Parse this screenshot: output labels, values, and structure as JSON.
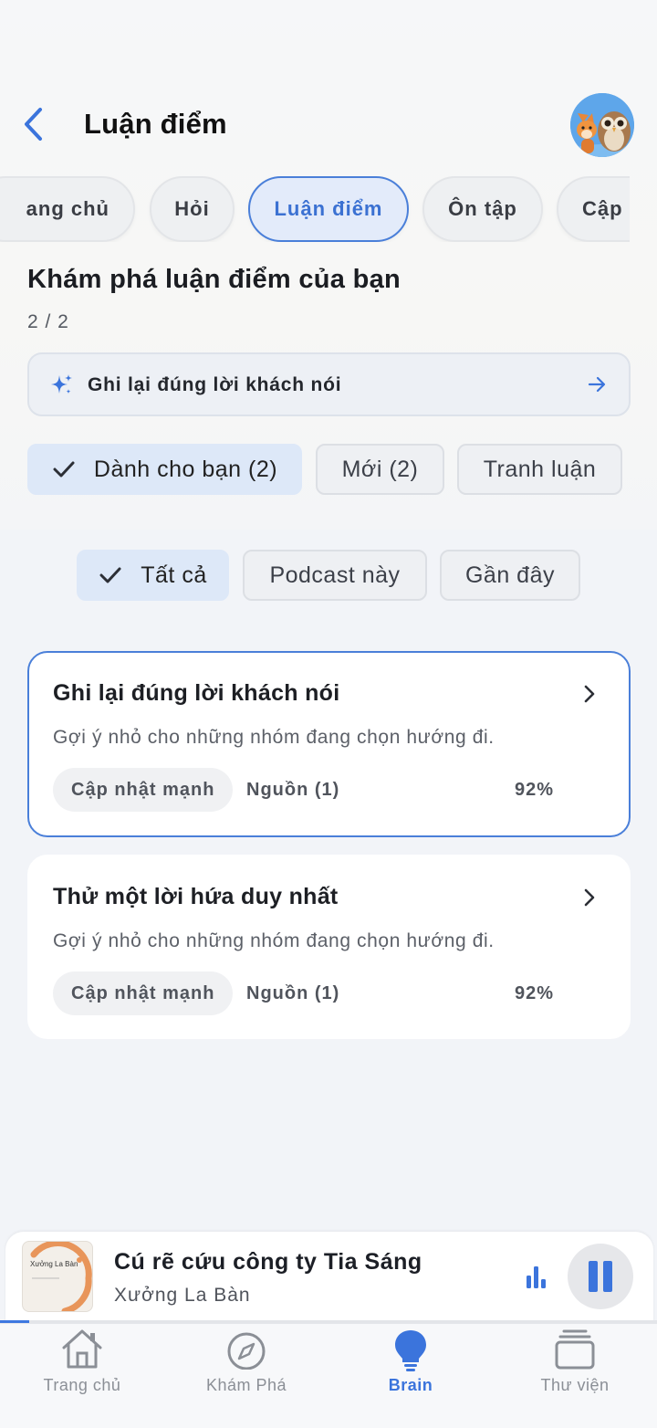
{
  "header": {
    "title": "Luận điểm"
  },
  "tabs": [
    {
      "label": "ang chủ",
      "active": false
    },
    {
      "label": "Hỏi",
      "active": false
    },
    {
      "label": "Luận điểm",
      "active": true
    },
    {
      "label": "Ôn tập",
      "active": false
    },
    {
      "label": "Cập",
      "active": false
    }
  ],
  "section": {
    "title": "Khám phá luận điểm của bạn",
    "page_count": "2 / 2"
  },
  "highlight": {
    "text": "Ghi lại đúng lời khách nói",
    "icon": "sparkle-icon",
    "arrow_icon": "arrow-right-icon"
  },
  "filters": [
    {
      "label": "Dành cho bạn (2)",
      "selected": true
    },
    {
      "label": "Mới (2)",
      "selected": false
    },
    {
      "label": "Tranh luận",
      "selected": false
    }
  ],
  "subfilters": [
    {
      "label": "Tất cả",
      "selected": true
    },
    {
      "label": "Podcast này",
      "selected": false
    },
    {
      "label": "Gần đây",
      "selected": false
    }
  ],
  "cards": [
    {
      "title": "Ghi lại đúng lời khách nói",
      "desc": "Gợi ý nhỏ cho những nhóm đang chọn hướng đi.",
      "tag": "Cập nhật mạnh",
      "source": "Nguồn (1)",
      "pct": "92%",
      "active": true
    },
    {
      "title": "Thử một lời hứa duy nhất",
      "desc": "Gợi ý nhỏ cho những nhóm đang chọn hướng đi.",
      "tag": "Cập nhật mạnh",
      "source": "Nguồn (1)",
      "pct": "92%",
      "active": false
    }
  ],
  "player": {
    "cover_text": "Xưởng La Bàn",
    "title": "Cú rẽ cứu công ty Tia Sáng",
    "subtitle": "Xưởng La Bàn",
    "progress": 0.045
  },
  "nav": [
    {
      "label": "Trang chủ",
      "icon": "home-icon",
      "active": false
    },
    {
      "label": "Khám Phá",
      "icon": "compass-icon",
      "active": false
    },
    {
      "label": "Brain",
      "icon": "lightbulb-icon",
      "active": true
    },
    {
      "label": "Thư viện",
      "icon": "library-icon",
      "active": false
    }
  ],
  "colors": {
    "accent": "#3b74dc",
    "background": "#f2f4f8"
  }
}
